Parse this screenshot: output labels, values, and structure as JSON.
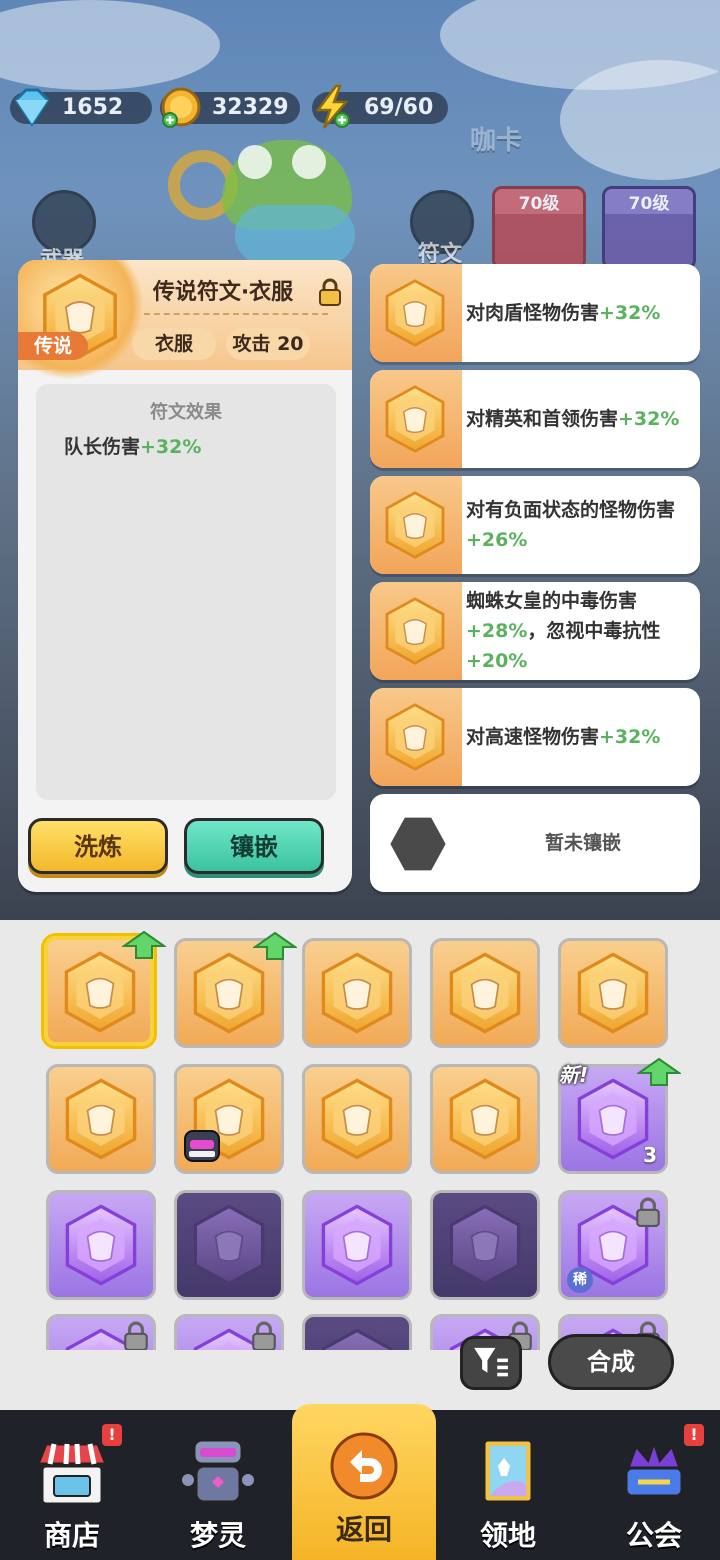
{
  "resources": {
    "gems": "1652",
    "gold": "32329",
    "energy": "69/60"
  },
  "background": {
    "weapon_tab": "武器",
    "rune_tab": "符文",
    "level_cards": [
      "70级",
      "70级"
    ],
    "sign_text": "咖卡"
  },
  "detail": {
    "title": "传说符文·衣服",
    "rarity_badge": "传说",
    "tag_type": "衣服",
    "tag_attack": "攻击 20",
    "effect_title": "符文效果",
    "effect_text": "队长伤害",
    "effect_value": "+32%",
    "btn_refine": "洗炼",
    "btn_inlay": "镶嵌"
  },
  "sockets": [
    {
      "text": "对肉盾怪物伤害",
      "value": "+32%"
    },
    {
      "text": "对精英和首领伤害",
      "value": "+32%"
    },
    {
      "text": "对有负面状态的怪物伤害",
      "value": "+26%"
    },
    {
      "text": "蜘蛛女皇的中毒伤害",
      "value": "+28%",
      "text2": "，忽视中毒抗性",
      "value2": "+20%"
    },
    {
      "text": "对高速怪物伤害",
      "value": "+32%"
    }
  ],
  "socket_empty": "暂未镶嵌",
  "inventory": {
    "new_label": "新!",
    "stack_count": "3",
    "rare_label": "稀",
    "combine_label": "合成"
  },
  "nav": {
    "shop": "商店",
    "dream": "梦灵",
    "back": "返回",
    "territory": "领地",
    "guild": "公会",
    "badge": "!"
  },
  "colors": {
    "bonus_green": "#59b35e",
    "legend_orange": "#e67a36",
    "refine_yellow": "#f3b82a",
    "inlay_teal": "#3cc29f"
  }
}
